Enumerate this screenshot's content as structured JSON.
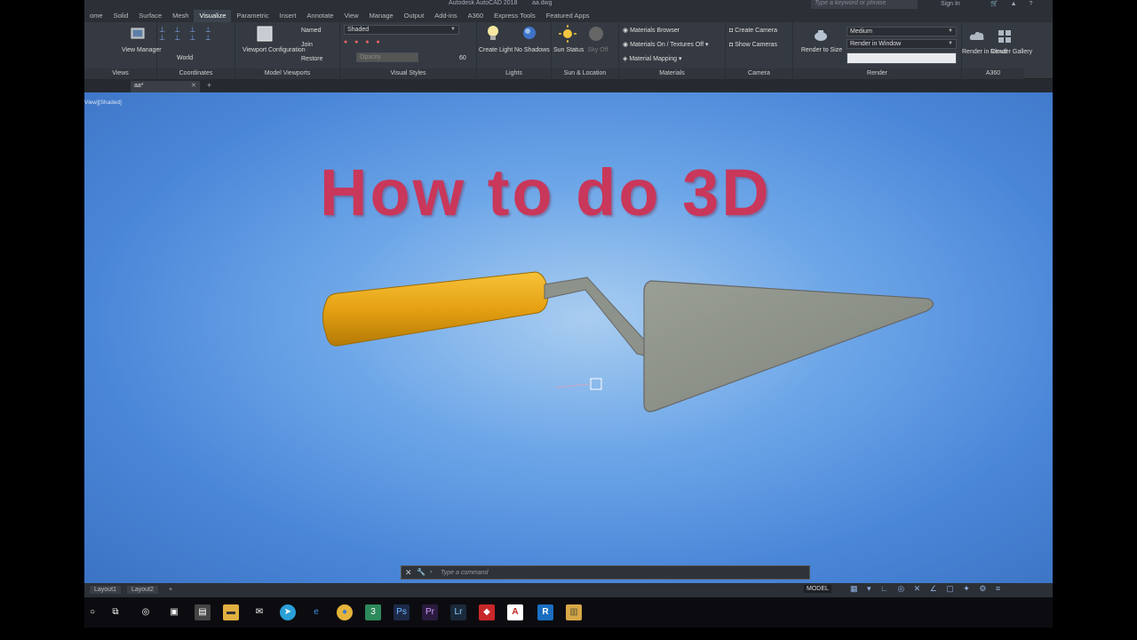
{
  "titlebar": {
    "app_title": "Autodesk AutoCAD 2018",
    "file_name": "aa.dwg",
    "search_placeholder": "Type a keyword or phrase",
    "sign_in": "Sign In"
  },
  "ribbon_tabs": [
    "ome",
    "Solid",
    "Surface",
    "Mesh",
    "Visualize",
    "Parametric",
    "Insert",
    "Annotate",
    "View",
    "Manage",
    "Output",
    "Add-ins",
    "A360",
    "Express Tools",
    "Featured Apps"
  ],
  "active_tab": "Visualize",
  "panels": {
    "views": {
      "title": "Views",
      "view_manager": "View Manager"
    },
    "coordinates": {
      "title": "Coordinates",
      "ucs_value": "World"
    },
    "model_viewports": {
      "title": "Model Viewports",
      "viewport_config": "Viewport Configuration",
      "named": "Named",
      "join": "Join",
      "restore": "Restore"
    },
    "visual_styles": {
      "title": "Visual Styles",
      "style_value": "Shaded",
      "opacity_placeholder": "Opacity",
      "opacity_value": "60"
    },
    "lights": {
      "title": "Lights",
      "create_light": "Create Light",
      "no_shadows": "No Shadows"
    },
    "sun_location": {
      "title": "Sun & Location",
      "sun_status": "Sun Status",
      "sky_off": "Sky Off"
    },
    "materials": {
      "title": "Materials",
      "browser": "Materials Browser",
      "on_textures": "Materials On / Textures Off",
      "mapping": "Material Mapping"
    },
    "camera": {
      "title": "Camera",
      "create_camera": "Create Camera",
      "show_cameras": "Show Cameras"
    },
    "render": {
      "title": "Render",
      "render_to_size": "Render to Size",
      "quality": "Medium",
      "render_target": "Render in Window"
    },
    "a360": {
      "title": "A360",
      "render_cloud": "Render in Cloud",
      "render_gallery": "Render Gallery"
    }
  },
  "doc_tab": {
    "name": "aa*"
  },
  "viewport": {
    "label": "View][Shaded]",
    "headline": "How to do 3D"
  },
  "command_line": {
    "placeholder": "Type a command"
  },
  "status": {
    "layouts": [
      "Layout1",
      "Layout2"
    ],
    "model": "MODEL"
  },
  "taskbar_icons": [
    "cortana-icon",
    "task-view-icon",
    "settings-icon",
    "media-icon",
    "store-icon",
    "explorer-icon",
    "mail-icon",
    "telegram-icon",
    "edge-icon",
    "chrome-icon",
    "app3-icon",
    "photoshop-icon",
    "premiere-icon",
    "lightroom-icon",
    "sketchup-icon",
    "autocad-icon",
    "revit-icon",
    "archive-icon"
  ],
  "colors": {
    "headline": "#c9375a",
    "viewport_bg": "#4a86d8",
    "handle": "#e0a010",
    "blade": "#8a8f86"
  }
}
